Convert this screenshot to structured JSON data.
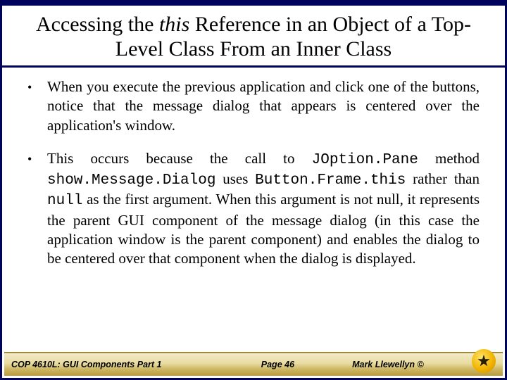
{
  "title": {
    "pre": "Accessing the ",
    "italic": "this",
    "post": " Reference in an Object of a Top-Level Class From an Inner Class"
  },
  "bullets": [
    {
      "text": "When you execute the previous application and click one of the buttons, notice that the message dialog that appears is centered over the application's window."
    },
    {
      "p1": "This occurs because the call to ",
      "c1": "JOption.Pane",
      "p2": " method ",
      "c2": "show.Message.Dialog",
      "p3": " uses ",
      "c3": "Button.Frame.this",
      "p4": " rather than ",
      "c4": "null",
      "p5": " as the first argument.  When this argument is not null, it represents the parent GUI component of the message dialog (in this case the application window is the parent component) and enables the dialog to be centered over that component when the dialog is displayed."
    }
  ],
  "footer": {
    "left": "COP 4610L: GUI Components Part 1",
    "center": "Page 46",
    "right": "Mark Llewellyn ©"
  }
}
